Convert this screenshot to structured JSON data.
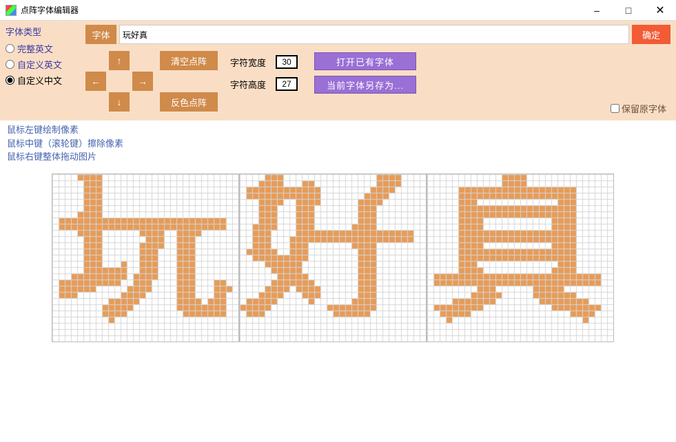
{
  "window": {
    "title": "点阵字体编辑器"
  },
  "fontTypeGroup": {
    "label": "字体类型",
    "options": [
      {
        "label": "完整英文",
        "checked": false
      },
      {
        "label": "自定义英文",
        "checked": false
      },
      {
        "label": "自定义中文",
        "checked": true
      }
    ]
  },
  "fontBtn": "字体",
  "fontInputValue": "玩好真",
  "confirmBtn": "确定",
  "arrows": {
    "up": "↑",
    "down": "↓",
    "left": "←",
    "right": "→"
  },
  "clearBtn": "清空点阵",
  "invertBtn": "反色点阵",
  "dims": {
    "widthLabel": "字符宽度",
    "widthValue": "30",
    "heightLabel": "字符高度",
    "heightValue": "27"
  },
  "openBtn": "打开已有字体",
  "saveAsBtn": "当前字体另存为...",
  "keepOriginal": {
    "label": "保留原字体",
    "checked": false
  },
  "hints": [
    "鼠标左键绘制像素",
    "鼠标中键（滚轮键）擦除像素",
    "鼠标右键整体拖动图片"
  ],
  "previewChars": "玩好真",
  "pixel": {
    "cols": 30,
    "rows": 27,
    "scale": 9
  },
  "colors": {
    "pixel": "#e69c58",
    "grid": "#d6d6d6",
    "accent": "#d08a4a",
    "purple": "#9a6fd6",
    "confirm": "#f25b35",
    "panel": "#f9dec5"
  }
}
